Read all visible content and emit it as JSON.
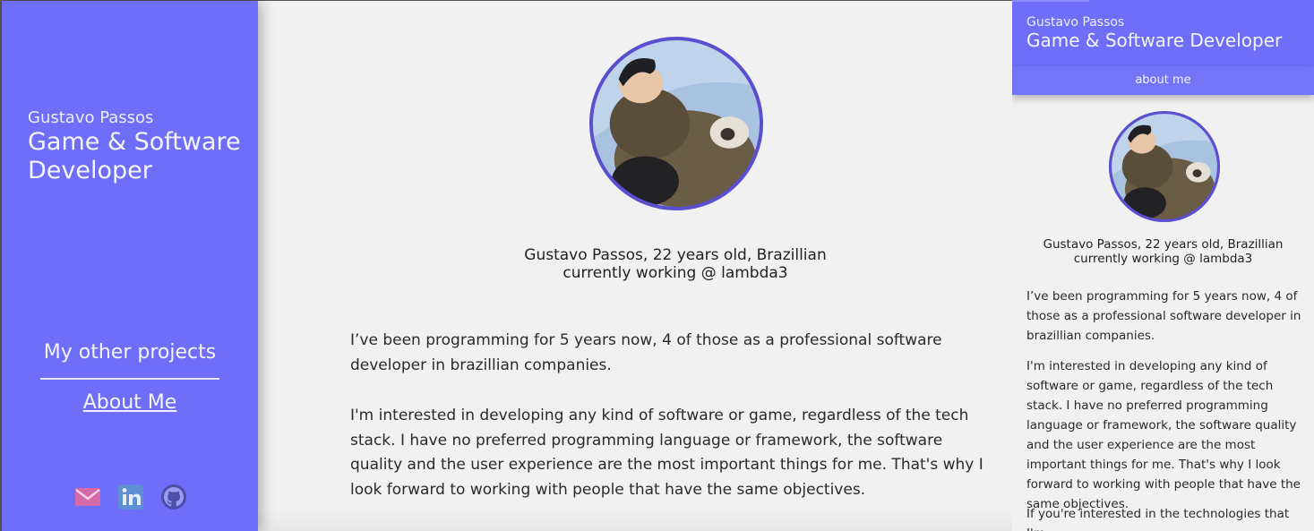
{
  "sidebar": {
    "name": "Gustavo Passos",
    "title": "Game & Software Developer",
    "nav": {
      "projects_label": "My other projects",
      "about_label": "About Me"
    },
    "socials": [
      {
        "icon": "mail-icon",
        "label": "Email"
      },
      {
        "icon": "linkedin-icon",
        "label": "LinkedIn"
      },
      {
        "icon": "github-icon",
        "label": "GitHub"
      }
    ]
  },
  "main": {
    "intro_line1": "Gustavo Passos, 22 years old, Brazillian",
    "intro_line2": "currently working @ lambda3",
    "paragraph1": "I’ve been programming for 5 years now, 4 of those as a professional software developer in brazillian companies.",
    "paragraph2": "I'm interested in developing any kind of software or game, regardless of the tech stack. I have no preferred programming language or framework, the software quality and the user experience are the most important things for me. That's why I look forward to working with people that have the same objectives."
  },
  "mobile": {
    "name": "Gustavo Passos",
    "title": "Game & Software Developer",
    "nav_label": "about me",
    "intro_line1": "Gustavo Passos, 22 years old, Brazillian",
    "intro_line2": "currently working @ lambda3",
    "paragraph1": "I’ve been programming for 5 years now, 4 of those as a professional software developer in brazillian companies.",
    "paragraph2": "I'm interested in developing any kind of software or game, regardless of the tech stack. I have no preferred programming language or framework, the software quality and the user experience are the most important things for me. That's why I look forward to working with people that have the same objectives.",
    "paragraph3": "If you're interested in the technologies that I'm"
  },
  "colors": {
    "accent": "#6e6ef9",
    "avatar_border": "#5a4fcf",
    "background": "#f1f1f1"
  }
}
